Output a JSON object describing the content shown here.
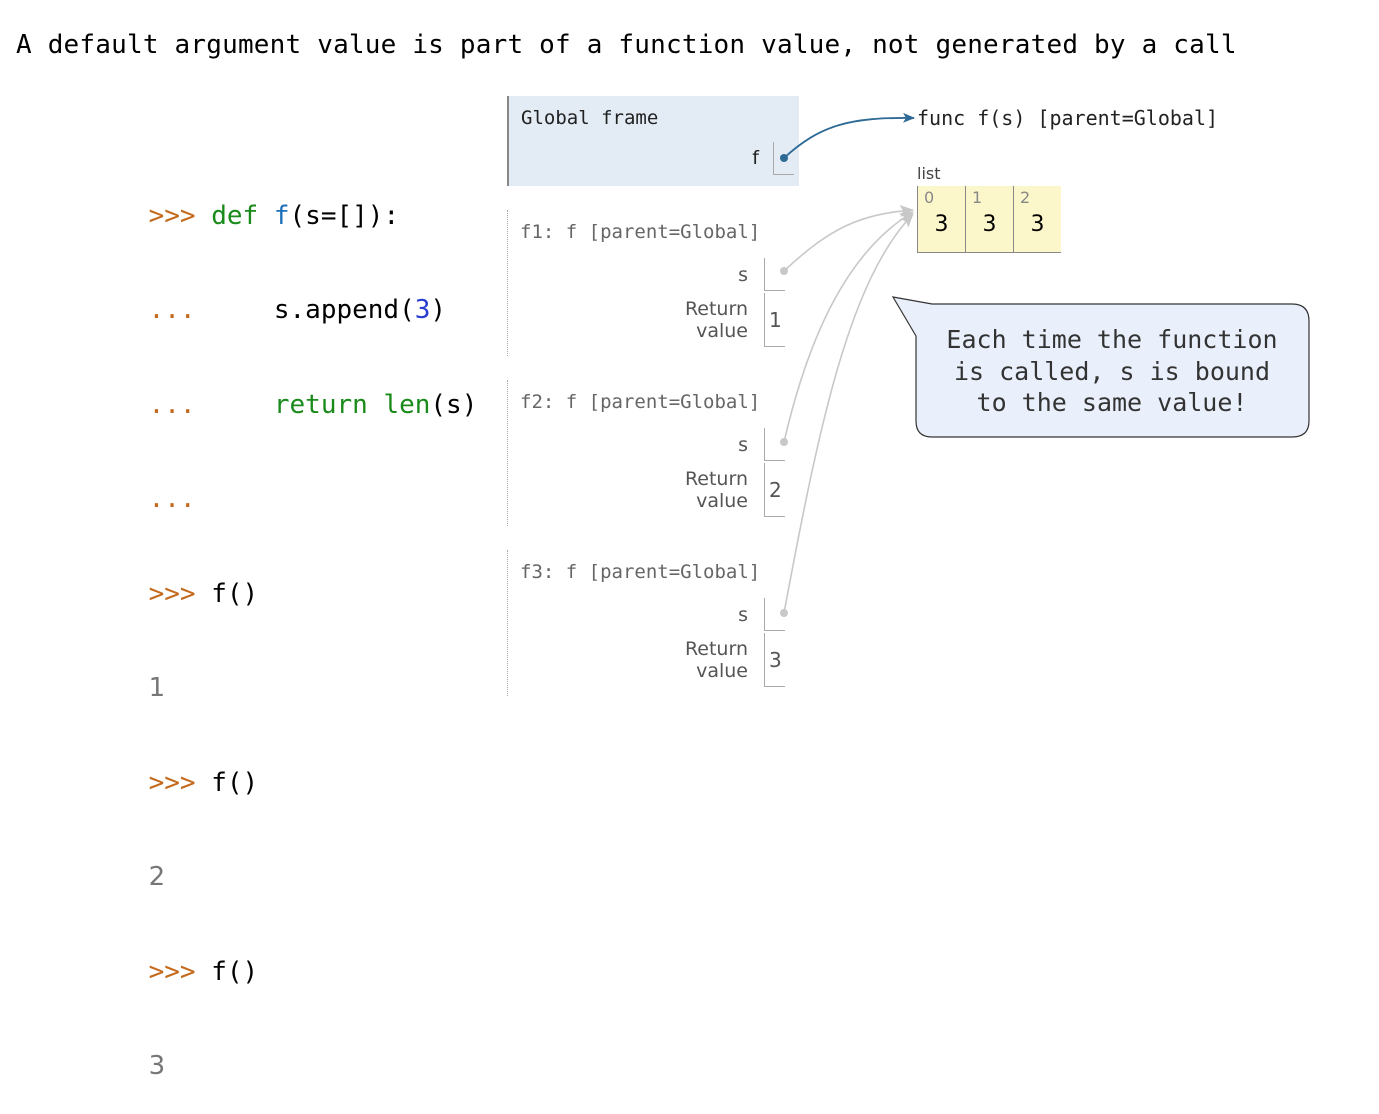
{
  "title": "A default argument value is part of a function value, not generated by a call",
  "code": {
    "lines": [
      {
        "prompt": ">>> ",
        "parts": [
          {
            "t": "def ",
            "c": "kw"
          },
          {
            "t": "f",
            "c": "fn"
          },
          {
            "t": "(s=[]):",
            "c": "plain"
          }
        ]
      },
      {
        "prompt": "...     ",
        "parts": [
          {
            "t": "s.append(",
            "c": "plain"
          },
          {
            "t": "3",
            "c": "num"
          },
          {
            "t": ")",
            "c": "plain"
          }
        ]
      },
      {
        "prompt": "...     ",
        "parts": [
          {
            "t": "return ",
            "c": "kw"
          },
          {
            "t": "len",
            "c": "kw"
          },
          {
            "t": "(s)",
            "c": "plain"
          }
        ]
      },
      {
        "prompt": "...",
        "parts": []
      },
      {
        "prompt": ">>> ",
        "parts": [
          {
            "t": "f()",
            "c": "plain"
          }
        ]
      },
      {
        "output": "1"
      },
      {
        "prompt": ">>> ",
        "parts": [
          {
            "t": "f()",
            "c": "plain"
          }
        ]
      },
      {
        "output": "2"
      },
      {
        "prompt": ">>> ",
        "parts": [
          {
            "t": "f()",
            "c": "plain"
          }
        ]
      },
      {
        "output": "3"
      }
    ]
  },
  "global_frame": {
    "title": "Global frame",
    "var": "f"
  },
  "function_object": {
    "label": "func f(s) [parent=Global]"
  },
  "list_object": {
    "label": "list",
    "items": [
      {
        "index": "0",
        "value": "3"
      },
      {
        "index": "1",
        "value": "3"
      },
      {
        "index": "2",
        "value": "3"
      }
    ]
  },
  "local_frames": [
    {
      "title": "f1: f [parent=Global]",
      "var": "s",
      "return_label_1": "Return",
      "return_label_2": "value",
      "return_value": "1"
    },
    {
      "title": "f2: f [parent=Global]",
      "var": "s",
      "return_label_1": "Return",
      "return_label_2": "value",
      "return_value": "2"
    },
    {
      "title": "f3: f [parent=Global]",
      "var": "s",
      "return_label_1": "Return",
      "return_label_2": "value",
      "return_value": "3"
    }
  ],
  "callout": {
    "text": "Each time the function\nis called, s is bound\nto the same value!"
  },
  "colors": {
    "prompt": "#c46a1d",
    "keyword": "#1a8a1a",
    "function_name": "#1c6fb8",
    "number": "#2a3fd0",
    "global_frame_bg": "#e3ebf5",
    "list_bg": "#fbf7cb",
    "pointer_active": "#2e6a96",
    "pointer_inactive": "#c8c8c8",
    "callout_bg": "#eaf0fb"
  }
}
